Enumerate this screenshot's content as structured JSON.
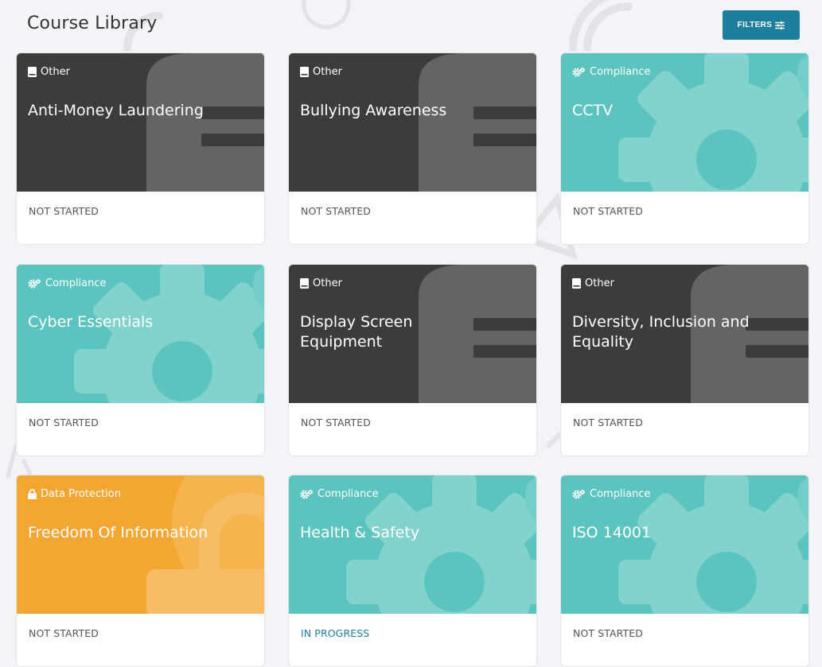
{
  "header": {
    "title": "Course Library",
    "filters_label": "FILTERS"
  },
  "theme": {
    "other_bg": "#3c3c3b",
    "compliance_bg": "#5cc4be",
    "data_protection_bg": "#f3a632",
    "accent": "#1e7e9e"
  },
  "courses": [
    {
      "category": "Other",
      "category_icon": "book-icon",
      "title": "Anti-Money Laundering",
      "status": "NOT STARTED"
    },
    {
      "category": "Other",
      "category_icon": "book-icon",
      "title": "Bullying Awareness",
      "status": "NOT STARTED"
    },
    {
      "category": "Compliance",
      "category_icon": "cogs-icon",
      "title": "CCTV",
      "status": "NOT STARTED"
    },
    {
      "category": "Compliance",
      "category_icon": "cogs-icon",
      "title": "Cyber Essentials",
      "status": "NOT STARTED"
    },
    {
      "category": "Other",
      "category_icon": "book-icon",
      "title": "Display Screen Equipment",
      "status": "NOT STARTED"
    },
    {
      "category": "Other",
      "category_icon": "book-icon",
      "title": "Diversity, Inclusion and Equality",
      "status": "NOT STARTED"
    },
    {
      "category": "Data Protection",
      "category_icon": "lock-icon",
      "title": "Freedom Of Information",
      "status": "NOT STARTED"
    },
    {
      "category": "Compliance",
      "category_icon": "cogs-icon",
      "title": "Health & Safety",
      "status": "IN PROGRESS"
    },
    {
      "category": "Compliance",
      "category_icon": "cogs-icon",
      "title": "ISO 14001",
      "status": "NOT STARTED"
    }
  ]
}
